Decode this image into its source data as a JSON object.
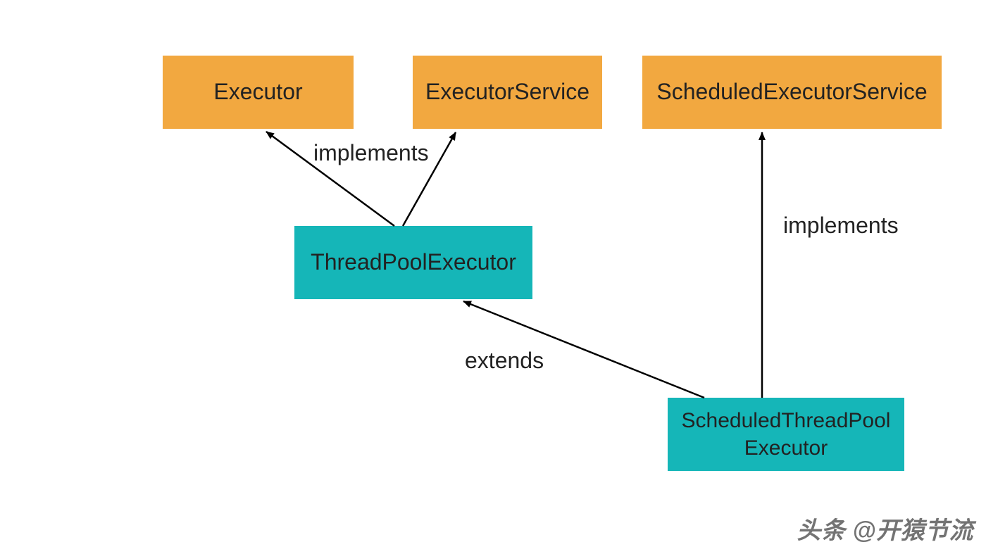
{
  "nodes": {
    "executor": {
      "label": "Executor"
    },
    "executorService": {
      "label": "ExecutorService"
    },
    "scheduledExecutorService": {
      "label": "ScheduledExecutorService"
    },
    "threadPoolExecutor": {
      "label": "ThreadPoolExecutor"
    },
    "scheduledThreadPoolExecutor": {
      "label": "ScheduledThreadPool\nExecutor"
    }
  },
  "edges": {
    "tpe_implements": {
      "label": "implements"
    },
    "stpe_extends": {
      "label": "extends"
    },
    "stpe_implements": {
      "label": "implements"
    }
  },
  "watermark": "头条 @开猿节流",
  "colors": {
    "interface": "#f2a840",
    "class": "#15b6b8"
  }
}
